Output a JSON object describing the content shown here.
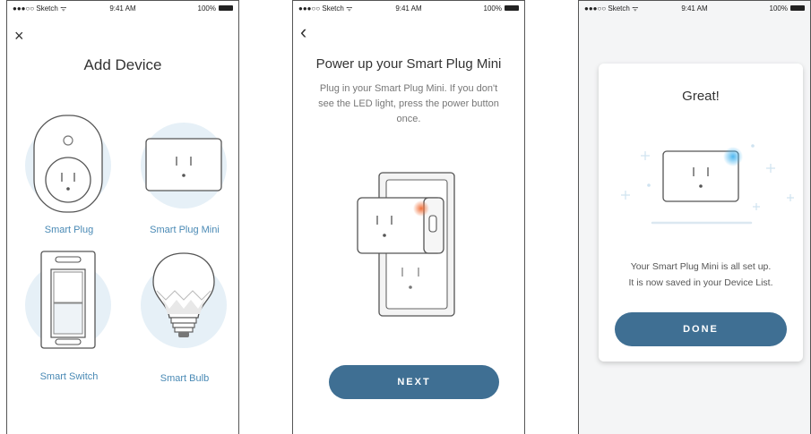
{
  "status_bar": {
    "carrier": "●●●○○ Sketch ᯤ",
    "time": "9:41 AM",
    "battery": "100%"
  },
  "screen1": {
    "close_icon": "×",
    "title": "Add Device",
    "devices": [
      {
        "label": "Smart Plug",
        "icon": "smart-plug-icon"
      },
      {
        "label": "Smart Plug Mini",
        "icon": "smart-plug-mini-icon"
      },
      {
        "label": "Smart Switch",
        "icon": "smart-switch-icon"
      },
      {
        "label": "Smart Bulb",
        "icon": "smart-bulb-icon"
      }
    ]
  },
  "screen2": {
    "back_icon": "‹",
    "title": "Power up your Smart Plug Mini",
    "description": "Plug in your Smart Plug Mini. If you don't see the LED light, press the power button once.",
    "next_label": "NEXT"
  },
  "screen3": {
    "title": "Great!",
    "message_line1": "Your Smart Plug Mini is all set up.",
    "message_line2": "It is now saved in your Device List.",
    "done_label": "DONE"
  },
  "colors": {
    "accent": "#3f6f93",
    "link": "#4a8ab5",
    "circle": "#e6f0f7",
    "led_orange": "#f08a5d",
    "led_blue": "#4fb8f0"
  }
}
